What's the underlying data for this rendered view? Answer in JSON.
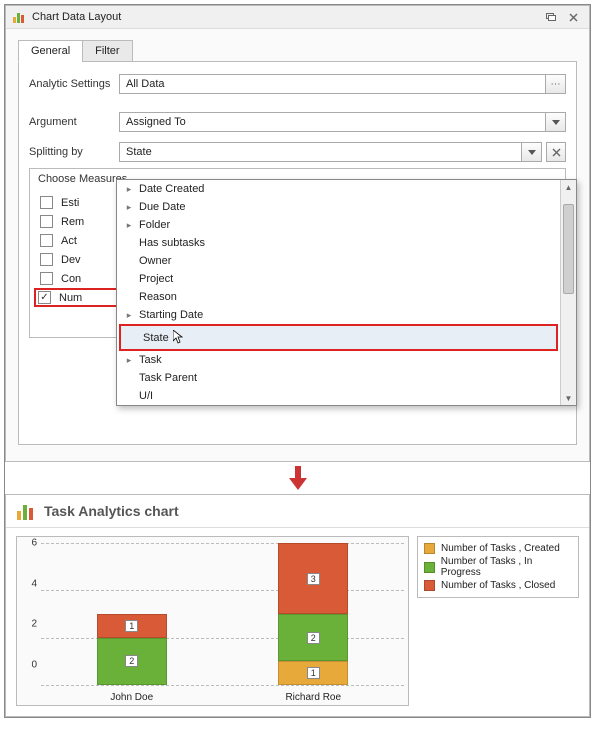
{
  "dialog": {
    "title": "Chart Data Layout",
    "tabs": [
      "General",
      "Filter"
    ],
    "active_tab": 0,
    "fields": {
      "analytic_label": "Analytic Settings",
      "analytic_value": "All Data",
      "argument_label": "Argument",
      "argument_value": "Assigned To",
      "splitting_label": "Splitting by",
      "splitting_value": "State"
    },
    "measures": {
      "title": "Choose Measures",
      "items": [
        {
          "label": "Estimated",
          "checked": false,
          "prefix": "Esti"
        },
        {
          "label": "Remaining",
          "checked": false,
          "prefix": "Rem"
        },
        {
          "label": "Actual",
          "checked": false,
          "prefix": "Act"
        },
        {
          "label": "Deviation",
          "checked": false,
          "prefix": "Dev"
        },
        {
          "label": "Completed",
          "checked": false,
          "prefix": "Con"
        },
        {
          "label": "Number of Tasks",
          "checked": true,
          "prefix": "Num",
          "highlight": true
        }
      ]
    },
    "dropdown": {
      "items": [
        {
          "label": "Date Created",
          "expandable": true
        },
        {
          "label": "Due Date",
          "expandable": true
        },
        {
          "label": "Folder",
          "expandable": true
        },
        {
          "label": "Has subtasks",
          "expandable": false
        },
        {
          "label": "Owner",
          "expandable": false
        },
        {
          "label": "Project",
          "expandable": false
        },
        {
          "label": "Reason",
          "expandable": false
        },
        {
          "label": "Starting Date",
          "expandable": true
        },
        {
          "label": "State",
          "expandable": false,
          "highlight": true
        },
        {
          "label": "Task",
          "expandable": true
        },
        {
          "label": "Task Parent",
          "expandable": false
        },
        {
          "label": "U/I",
          "expandable": false
        }
      ]
    }
  },
  "chart_title": "Task Analytics chart",
  "colors": {
    "created": "#e7a93a",
    "inprog": "#6ab13a",
    "closed": "#d85a36"
  },
  "chart_data": {
    "type": "bar",
    "stacked": true,
    "categories": [
      "John Doe",
      "Richard Roe"
    ],
    "series": [
      {
        "name": "Number of Tasks , Created",
        "values": [
          0,
          1
        ],
        "color": "#e7a93a"
      },
      {
        "name": "Number of Tasks , In Progress",
        "values": [
          2,
          2
        ],
        "color": "#6ab13a"
      },
      {
        "name": "Number of Tasks , Closed",
        "values": [
          1,
          3
        ],
        "color": "#d85a36"
      }
    ],
    "ylim": [
      0,
      6
    ],
    "yticks": [
      0,
      2,
      4,
      6
    ],
    "xlabel": "",
    "ylabel": "",
    "title": "Task Analytics chart"
  }
}
